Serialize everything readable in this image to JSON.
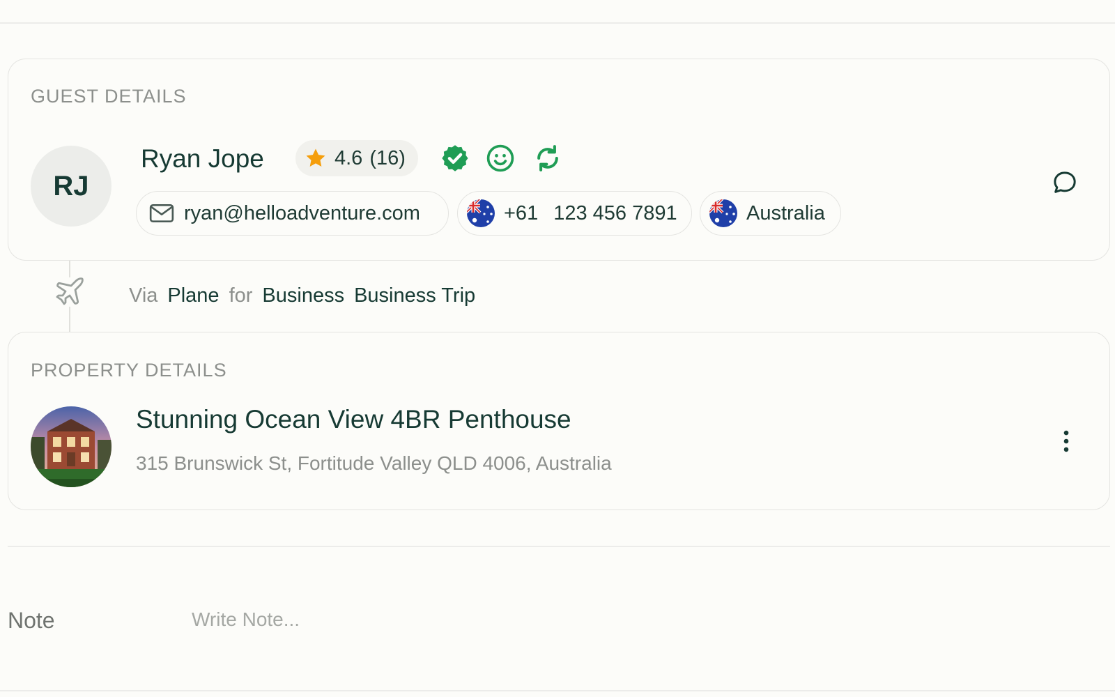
{
  "guest": {
    "section_label": "GUEST DETAILS",
    "initials": "RJ",
    "name": "Ryan Jope",
    "rating": "4.6",
    "rating_count": "(16)",
    "email": "ryan@helloadventure.com",
    "phone_code": "+61",
    "phone_number": "123 456 7891",
    "country": "Australia"
  },
  "travel": {
    "via_label": "Via",
    "mode": "Plane",
    "for_label": "for",
    "purpose": "Business",
    "reason": "Business Trip"
  },
  "property": {
    "section_label": "PROPERTY DETAILS",
    "title": "Stunning Ocean View 4BR Penthouse",
    "address": "315 Brunswick St, Fortitude Valley QLD 4006, Australia"
  },
  "note": {
    "label": "Note",
    "placeholder": "Write Note..."
  },
  "icons": {
    "rating": "star-icon",
    "verified": "verified-badge-icon",
    "smile": "smile-icon",
    "repeat": "repeat-guest-icon",
    "mail": "mail-icon",
    "flag": "australia-flag-icon",
    "chat": "chat-bubble-icon",
    "plane": "plane-icon",
    "more": "more-vertical-icon"
  },
  "colors": {
    "accent_green": "#1f9d55",
    "star_orange": "#f59e0b",
    "text_dark": "#163a33",
    "text_muted": "#8c8f8c"
  }
}
